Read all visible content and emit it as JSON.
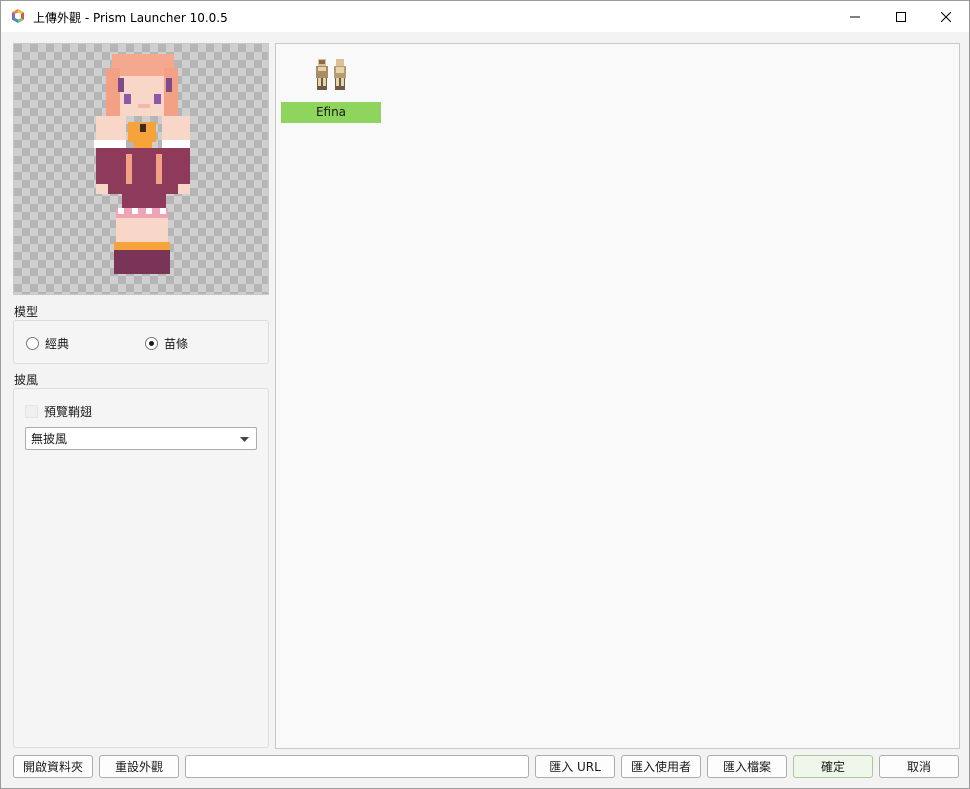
{
  "window": {
    "title": "上傳外觀 - Prism Launcher 10.0.5",
    "icon": "prism-launcher-logo"
  },
  "window_controls": {
    "minimize_icon": "minimize-icon",
    "maximize_icon": "maximize-icon",
    "close_icon": "close-icon"
  },
  "model": {
    "label": "模型",
    "options": [
      {
        "label": "經典",
        "checked": false
      },
      {
        "label": "苗條",
        "checked": true
      }
    ]
  },
  "cape": {
    "label": "披風",
    "preview_elytra_label": "預覽鞘翅",
    "preview_elytra_checked": false,
    "selected": "無披風"
  },
  "skins": [
    {
      "name": "Efina",
      "selected": true
    }
  ],
  "buttons": {
    "open_folder": "開啟資料夾",
    "reset_skin": "重設外觀",
    "url_value": "",
    "import_url": "匯入 URL",
    "import_user": "匯入使用者",
    "import_file": "匯入檔案",
    "ok": "確定",
    "cancel": "取消"
  },
  "colors": {
    "selected_skin_bg": "#8fd45c",
    "ok_button_bg": "#eef7ea"
  }
}
